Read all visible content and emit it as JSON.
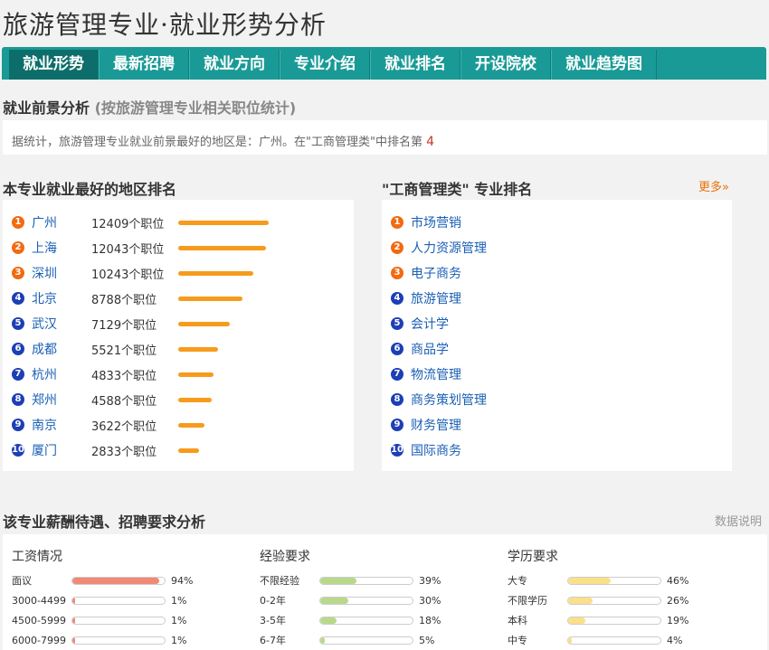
{
  "page": {
    "title": "旅游管理专业·就业形势分析"
  },
  "tabs": [
    {
      "label": "就业形势"
    },
    {
      "label": "最新招聘"
    },
    {
      "label": "就业方向"
    },
    {
      "label": "专业介绍"
    },
    {
      "label": "就业排名"
    },
    {
      "label": "开设院校"
    },
    {
      "label": "就业趋势图"
    }
  ],
  "prospect": {
    "title": "就业前景分析",
    "subtitle": "(按旅游管理专业相关职位统计)",
    "note_text": "据统计，旅游管理专业就业前景最好的地区是：广州。在\"工商管理类\"中排名第",
    "rank": "4"
  },
  "region_rank": {
    "title": "本专业就业最好的地区排名",
    "unit": "个职位",
    "items": [
      {
        "no": "1",
        "city": "广州",
        "count": 12409
      },
      {
        "no": "2",
        "city": "上海",
        "count": 12043
      },
      {
        "no": "3",
        "city": "深圳",
        "count": 10243
      },
      {
        "no": "4",
        "city": "北京",
        "count": 8788
      },
      {
        "no": "5",
        "city": "武汉",
        "count": 7129
      },
      {
        "no": "6",
        "city": "成都",
        "count": 5521
      },
      {
        "no": "7",
        "city": "杭州",
        "count": 4833
      },
      {
        "no": "8",
        "city": "郑州",
        "count": 4588
      },
      {
        "no": "9",
        "city": "南京",
        "count": 3622
      },
      {
        "no": "10",
        "city": "厦门",
        "count": 2833
      }
    ]
  },
  "major_rank": {
    "title": "\"工商管理类\" 专业排名",
    "more": "更多»",
    "items": [
      {
        "no": "1",
        "name": "市场营销"
      },
      {
        "no": "2",
        "name": "人力资源管理"
      },
      {
        "no": "3",
        "name": "电子商务"
      },
      {
        "no": "4",
        "name": "旅游管理"
      },
      {
        "no": "5",
        "name": "会计学"
      },
      {
        "no": "6",
        "name": "商品学"
      },
      {
        "no": "7",
        "name": "物流管理"
      },
      {
        "no": "8",
        "name": "商务策划管理"
      },
      {
        "no": "9",
        "name": "财务管理"
      },
      {
        "no": "10",
        "name": "国际商务"
      }
    ]
  },
  "salary": {
    "title": "该专业薪酬待遇、招聘要求分析",
    "data_note": "数据说明",
    "columns": [
      {
        "title": "工资情况",
        "color": "#f08a76",
        "rows": [
          {
            "label": "面议",
            "pct": 94
          },
          {
            "label": "3000-4499",
            "pct": 1
          },
          {
            "label": "4500-5999",
            "pct": 1
          },
          {
            "label": "6000-7999",
            "pct": 1
          }
        ]
      },
      {
        "title": "经验要求",
        "color": "#b8d98a",
        "rows": [
          {
            "label": "不限经验",
            "pct": 39
          },
          {
            "label": "0-2年",
            "pct": 30
          },
          {
            "label": "3-5年",
            "pct": 18
          },
          {
            "label": "6-7年",
            "pct": 5
          }
        ]
      },
      {
        "title": "学历要求",
        "color": "#fbe08a",
        "rows": [
          {
            "label": "大专",
            "pct": 46
          },
          {
            "label": "不限学历",
            "pct": 26
          },
          {
            "label": "本科",
            "pct": 19
          },
          {
            "label": "中专",
            "pct": 4
          }
        ]
      }
    ]
  }
}
